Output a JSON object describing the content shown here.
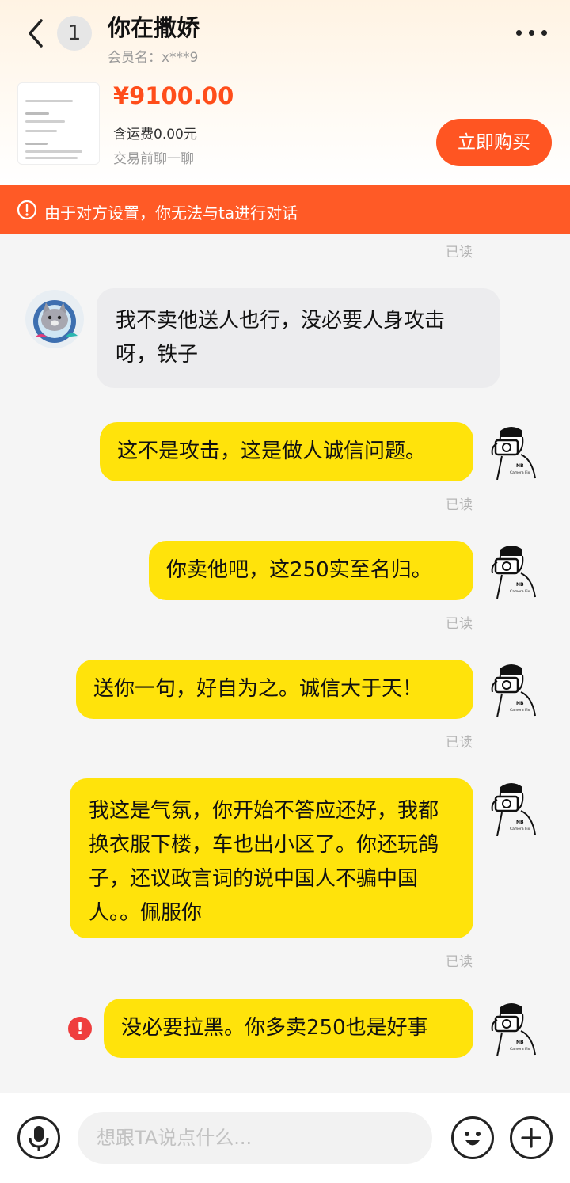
{
  "header": {
    "unread_count": "1",
    "title": "你在撒娇",
    "member_label": "会员名：x***9"
  },
  "product": {
    "price": "¥9100.00",
    "shipping": "含运费0.00元",
    "pre_chat": "交易前聊一聊",
    "buy_label": "立即购买"
  },
  "warning": {
    "text": "由于对方设置，你无法与ta进行对话"
  },
  "messages": [
    {
      "from": "them",
      "text": "我不卖他送人也行，没必要人身攻击呀，铁子"
    },
    {
      "from": "me",
      "text": "这不是攻击，这是做人诚信问题。",
      "status": "已读"
    },
    {
      "from": "me",
      "text": "你卖他吧，这250实至名归。",
      "status": "已读"
    },
    {
      "from": "me",
      "text": "送你一句，好自为之。诚信大于天！",
      "status": "已读"
    },
    {
      "from": "me",
      "text": "我这是气氛，你开始不答应还好，我都换衣服下楼，车也出小区了。你还玩鸽子，还议政言词的说中国人不骗中国人。。佩服你",
      "status": "已读"
    },
    {
      "from": "me",
      "text": "没必要拉黑。你多卖250也是好事",
      "status": "failed"
    }
  ],
  "top_read": "已读",
  "input": {
    "placeholder": "想跟TA说点什么..."
  },
  "icons": {
    "back": "chevron-left-icon",
    "more": "more-dots-icon",
    "warning": "alert-circle-icon",
    "mic": "microphone-icon",
    "emoji": "emoji-icon",
    "plus": "plus-icon",
    "failed": "send-failed-icon"
  },
  "colors": {
    "accent": "#ff5522",
    "warning_bar": "#ff5a26",
    "my_bubble": "#ffe30b",
    "their_bubble": "#ececee",
    "failed": "#ef3e3e"
  }
}
